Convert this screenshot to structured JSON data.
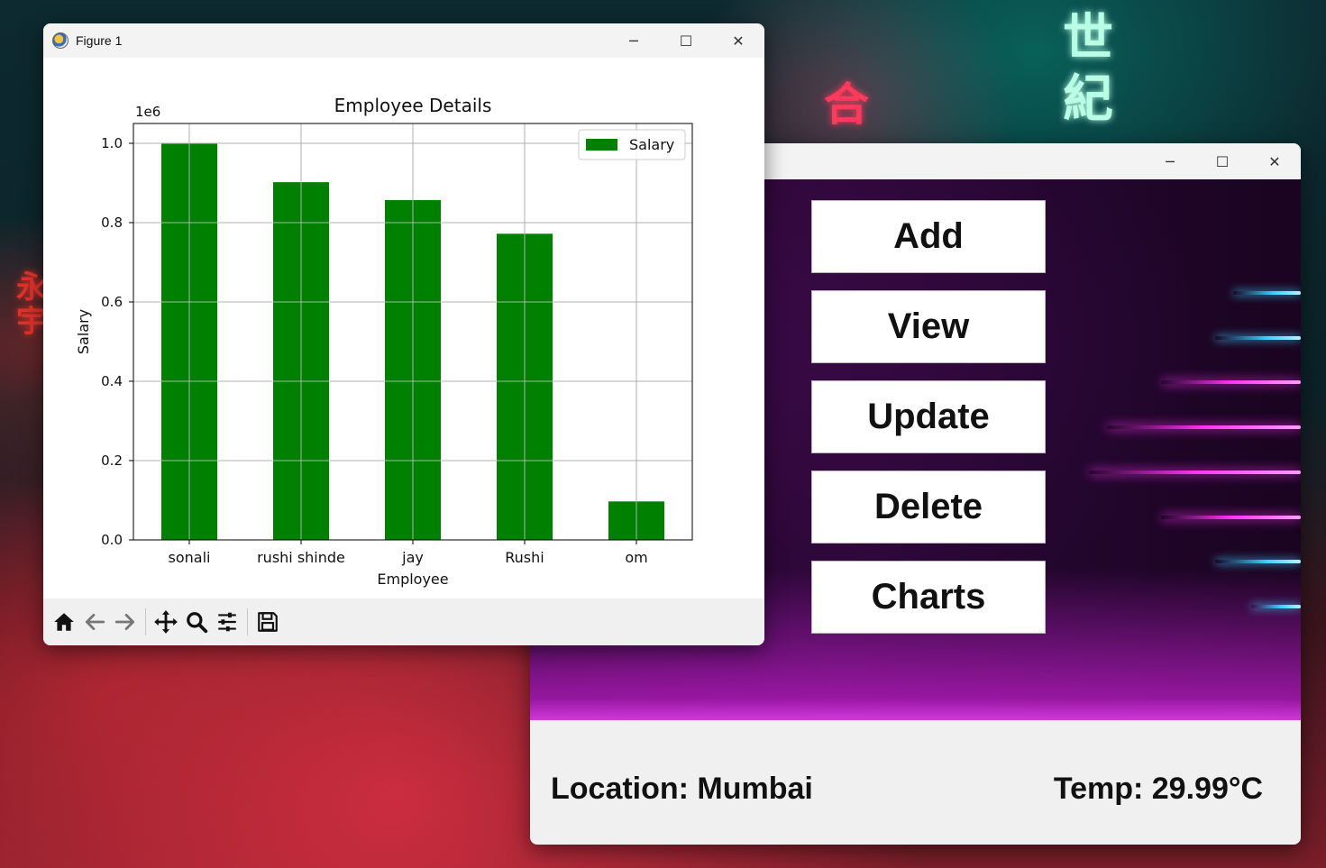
{
  "desktop": {
    "neon_top_right": "世\n紀",
    "neon_top_center": "合",
    "neon_left": "永\n宇"
  },
  "app_window": {
    "controls": {
      "minimize": "─",
      "maximize": "☐",
      "close": "✕"
    },
    "buttons": [
      "Add",
      "View",
      "Update",
      "Delete",
      "Charts"
    ],
    "location_label": "Location: Mumbai",
    "temp_label": "Temp: 29.99°C"
  },
  "figure_window": {
    "title": "Figure 1",
    "controls": {
      "minimize": "─",
      "maximize": "☐",
      "close": "✕"
    },
    "toolbar_icons": [
      "home-icon",
      "back-arrow-icon",
      "forward-arrow-icon",
      "pan-icon",
      "zoom-icon",
      "configure-subplots-icon",
      "save-icon"
    ]
  },
  "chart_data": {
    "type": "bar",
    "title": "Employee Details",
    "xlabel": "Employee",
    "ylabel": "Salary",
    "offset_label": "1e6",
    "categories": [
      "sonali",
      "rushi shinde",
      "jay",
      "Rushi",
      "om"
    ],
    "series": [
      {
        "name": "Salary",
        "values": [
          1000000,
          902000,
          857000,
          772000,
          97000
        ],
        "color": "#008000"
      }
    ],
    "ylim": [
      0,
      1050000
    ],
    "yticks": [
      0,
      200000,
      400000,
      600000,
      800000,
      1000000
    ],
    "ytick_labels": [
      "0.0",
      "0.2",
      "0.4",
      "0.6",
      "0.8",
      "1.0"
    ],
    "grid": true,
    "legend": "top-right"
  }
}
